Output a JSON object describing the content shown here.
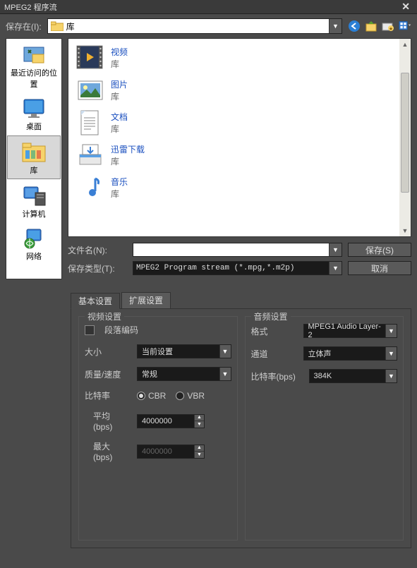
{
  "title": "MPEG2 程序流",
  "savebar": {
    "save_in_label": "保存在(I):",
    "path_value": "库"
  },
  "sidebar": {
    "items": [
      {
        "label": "最近访问的位置"
      },
      {
        "label": "桌面"
      },
      {
        "label": "库"
      },
      {
        "label": "计算机"
      },
      {
        "label": "网络"
      }
    ]
  },
  "filelist": {
    "items": [
      {
        "name": "视频",
        "sub": "库"
      },
      {
        "name": "图片",
        "sub": "库"
      },
      {
        "name": "文档",
        "sub": "库"
      },
      {
        "name": "迅雷下载",
        "sub": "库"
      },
      {
        "name": "音乐",
        "sub": "库"
      }
    ]
  },
  "fields": {
    "filename_label": "文件名(N):",
    "filename_value": "",
    "filetype_label": "保存类型(T):",
    "filetype_value": "MPEG2 Program stream (*.mpg,*.m2p)",
    "save_btn": "保存(S)",
    "cancel_btn": "取消"
  },
  "tabs": {
    "basic": "基本设置",
    "ext": "扩展设置"
  },
  "video": {
    "legend": "视频设置",
    "segmented_label": "段落编码",
    "size_label": "大小",
    "size_value": "当前设置",
    "quality_label": "质量/速度",
    "quality_value": "常规",
    "bitrate_label": "比特率",
    "cbr_label": "CBR",
    "vbr_label": "VBR",
    "avg_label": "平均 (bps)",
    "avg_value": "4000000",
    "max_label": "最大 (bps)",
    "max_value": "4000000"
  },
  "audio": {
    "legend": "音频设置",
    "format_label": "格式",
    "format_value": "MPEG1 Audio Layer-2",
    "channel_label": "通道",
    "channel_value": "立体声",
    "bitrate_label": "比特率(bps)",
    "bitrate_value": "384K"
  }
}
